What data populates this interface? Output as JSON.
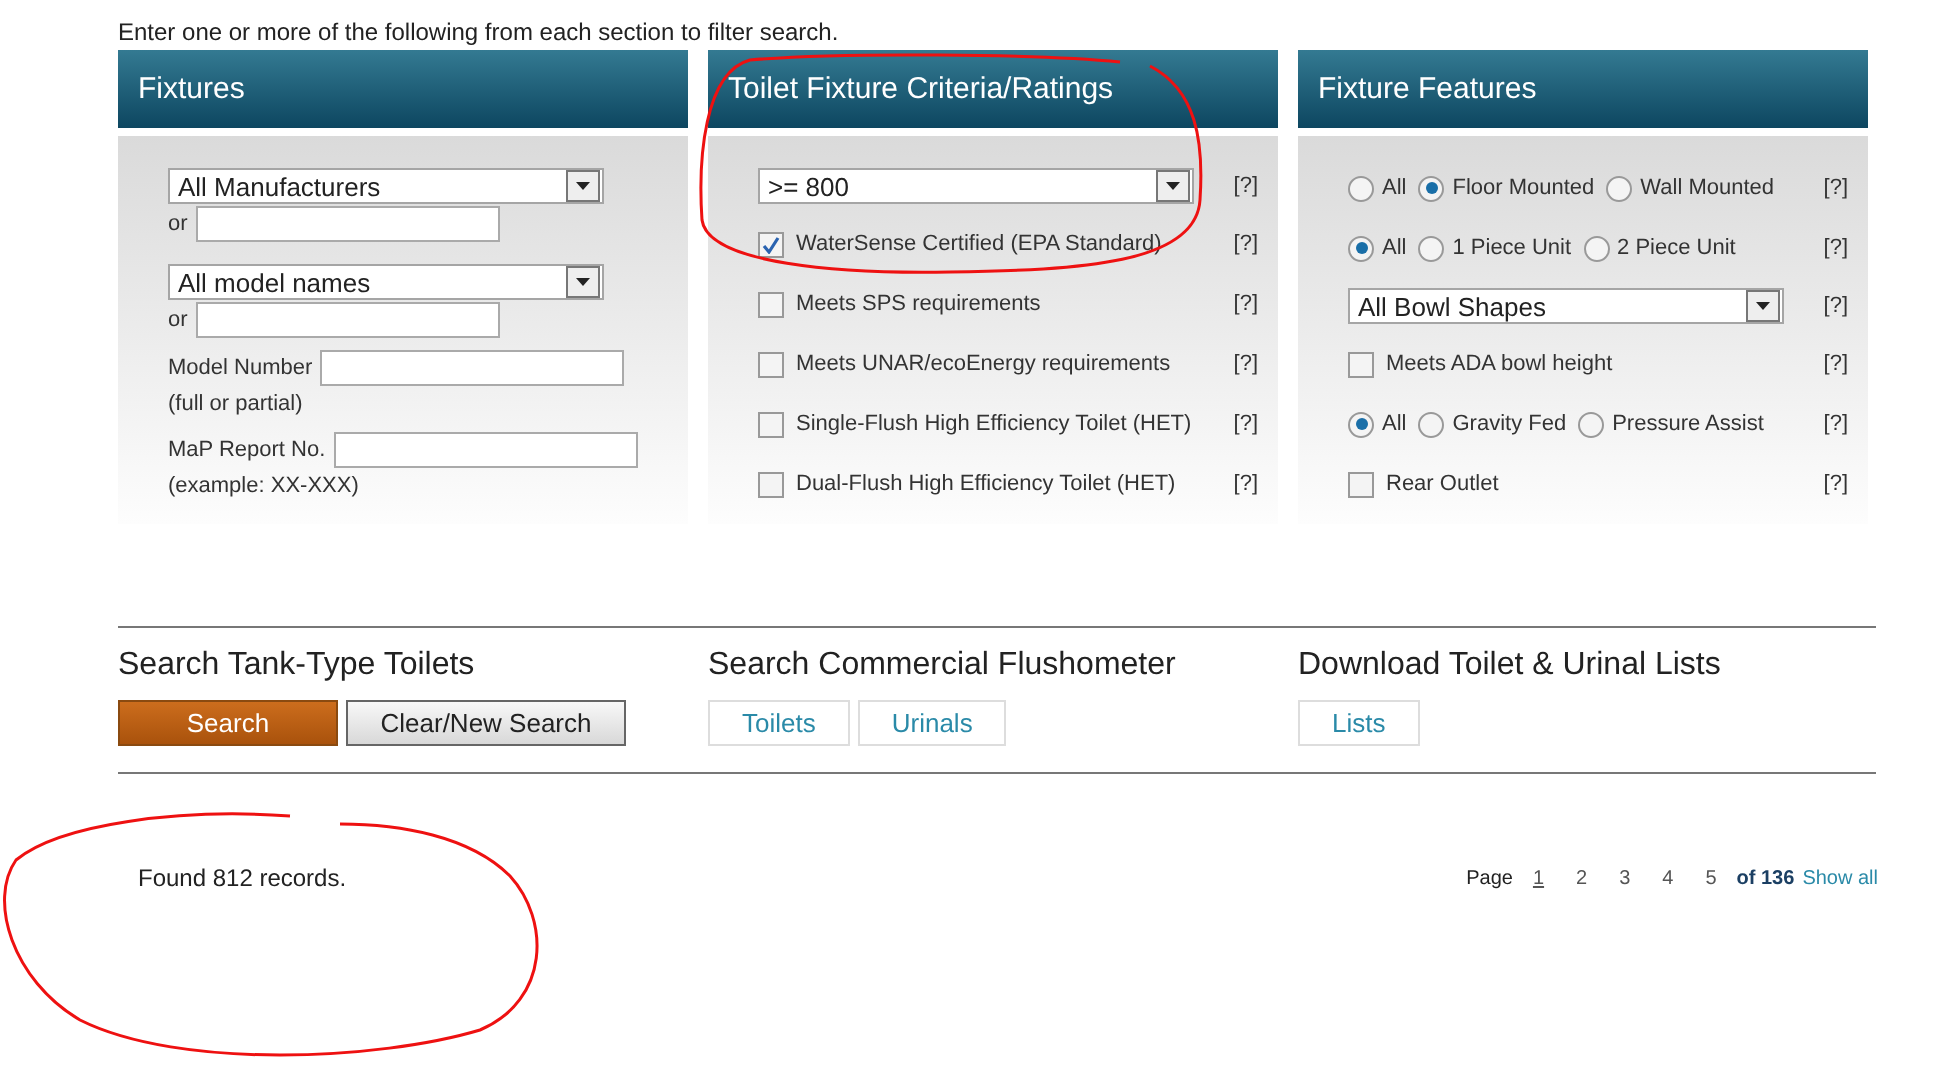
{
  "intro": "Enter one or more of the following from each section to filter search.",
  "panels": [
    {
      "title": "Fixtures",
      "rows": [
        {
          "kind": "select",
          "value": "All Manufacturers"
        },
        {
          "kind": "or_field",
          "label": "or"
        },
        {
          "kind": "select",
          "value": "All model names"
        },
        {
          "kind": "or_field",
          "label": "or"
        },
        {
          "kind": "labeled_field",
          "label": "Model Number",
          "note": "(full or partial)"
        },
        {
          "kind": "labeled_field",
          "label": "MaP Report No.",
          "note": "(example: XX-XXX)"
        }
      ]
    },
    {
      "title": "Toilet Fixture Criteria/Ratings",
      "rows": [
        {
          "kind": "select",
          "value": ">= 800",
          "help": "[?]"
        },
        {
          "kind": "checkbox",
          "label": "WaterSense Certified (EPA Standard)",
          "checked": true,
          "help": "[?]"
        },
        {
          "kind": "checkbox",
          "label": "Meets SPS requirements",
          "checked": false,
          "help": "[?]"
        },
        {
          "kind": "checkbox",
          "label": "Meets UNAR/ecoEnergy requirements",
          "checked": false,
          "help": "[?]"
        },
        {
          "kind": "checkbox",
          "label": "Single-Flush High Efficiency Toilet (HET)",
          "checked": false,
          "help": "[?]"
        },
        {
          "kind": "checkbox",
          "label": "Dual-Flush High Efficiency Toilet (HET)",
          "checked": false,
          "help": "[?]"
        }
      ]
    },
    {
      "title": "Fixture Features",
      "rows": [
        {
          "kind": "radio_group",
          "help": "[?]",
          "options": [
            {
              "label": "All",
              "selected": false
            },
            {
              "label": "Floor Mounted",
              "selected": true
            },
            {
              "label": "Wall Mounted",
              "selected": false
            }
          ]
        },
        {
          "kind": "radio_group",
          "help": "[?]",
          "options": [
            {
              "label": "All",
              "selected": true
            },
            {
              "label": "1 Piece Unit",
              "selected": false
            },
            {
              "label": "2 Piece Unit",
              "selected": false
            }
          ]
        },
        {
          "kind": "select",
          "value": "All Bowl Shapes",
          "help": "[?]"
        },
        {
          "kind": "checkbox",
          "label": "Meets ADA bowl height",
          "checked": false,
          "help": "[?]"
        },
        {
          "kind": "radio_group",
          "help": "[?]",
          "options": [
            {
              "label": "All",
              "selected": true
            },
            {
              "label": "Gravity Fed",
              "selected": false
            },
            {
              "label": "Pressure Assist",
              "selected": false
            }
          ]
        },
        {
          "kind": "checkbox",
          "label": "Rear Outlet",
          "checked": false,
          "help": "[?]"
        }
      ]
    }
  ],
  "actions": [
    {
      "title": "Search Tank-Type Toilets",
      "buttons": [
        {
          "label": "Search",
          "kind": "primary"
        },
        {
          "label": "Clear/New Search",
          "kind": "secondary"
        }
      ]
    },
    {
      "title": "Search Commercial Flushometer",
      "buttons": [
        {
          "label": "Toilets",
          "kind": "link"
        },
        {
          "label": "Urinals",
          "kind": "link"
        }
      ]
    },
    {
      "title": "Download Toilet & Urinal Lists",
      "buttons": [
        {
          "label": "Lists",
          "kind": "link"
        }
      ]
    }
  ],
  "results": {
    "summary": "Found 812 records.",
    "pagination": {
      "label": "Page",
      "pages": [
        {
          "label": "1",
          "selected": true
        },
        {
          "label": "2",
          "selected": false
        },
        {
          "label": "3",
          "selected": false
        },
        {
          "label": "4",
          "selected": false
        },
        {
          "label": "5",
          "selected": false
        }
      ],
      "total": "of 136",
      "show_all": "Show all"
    }
  }
}
